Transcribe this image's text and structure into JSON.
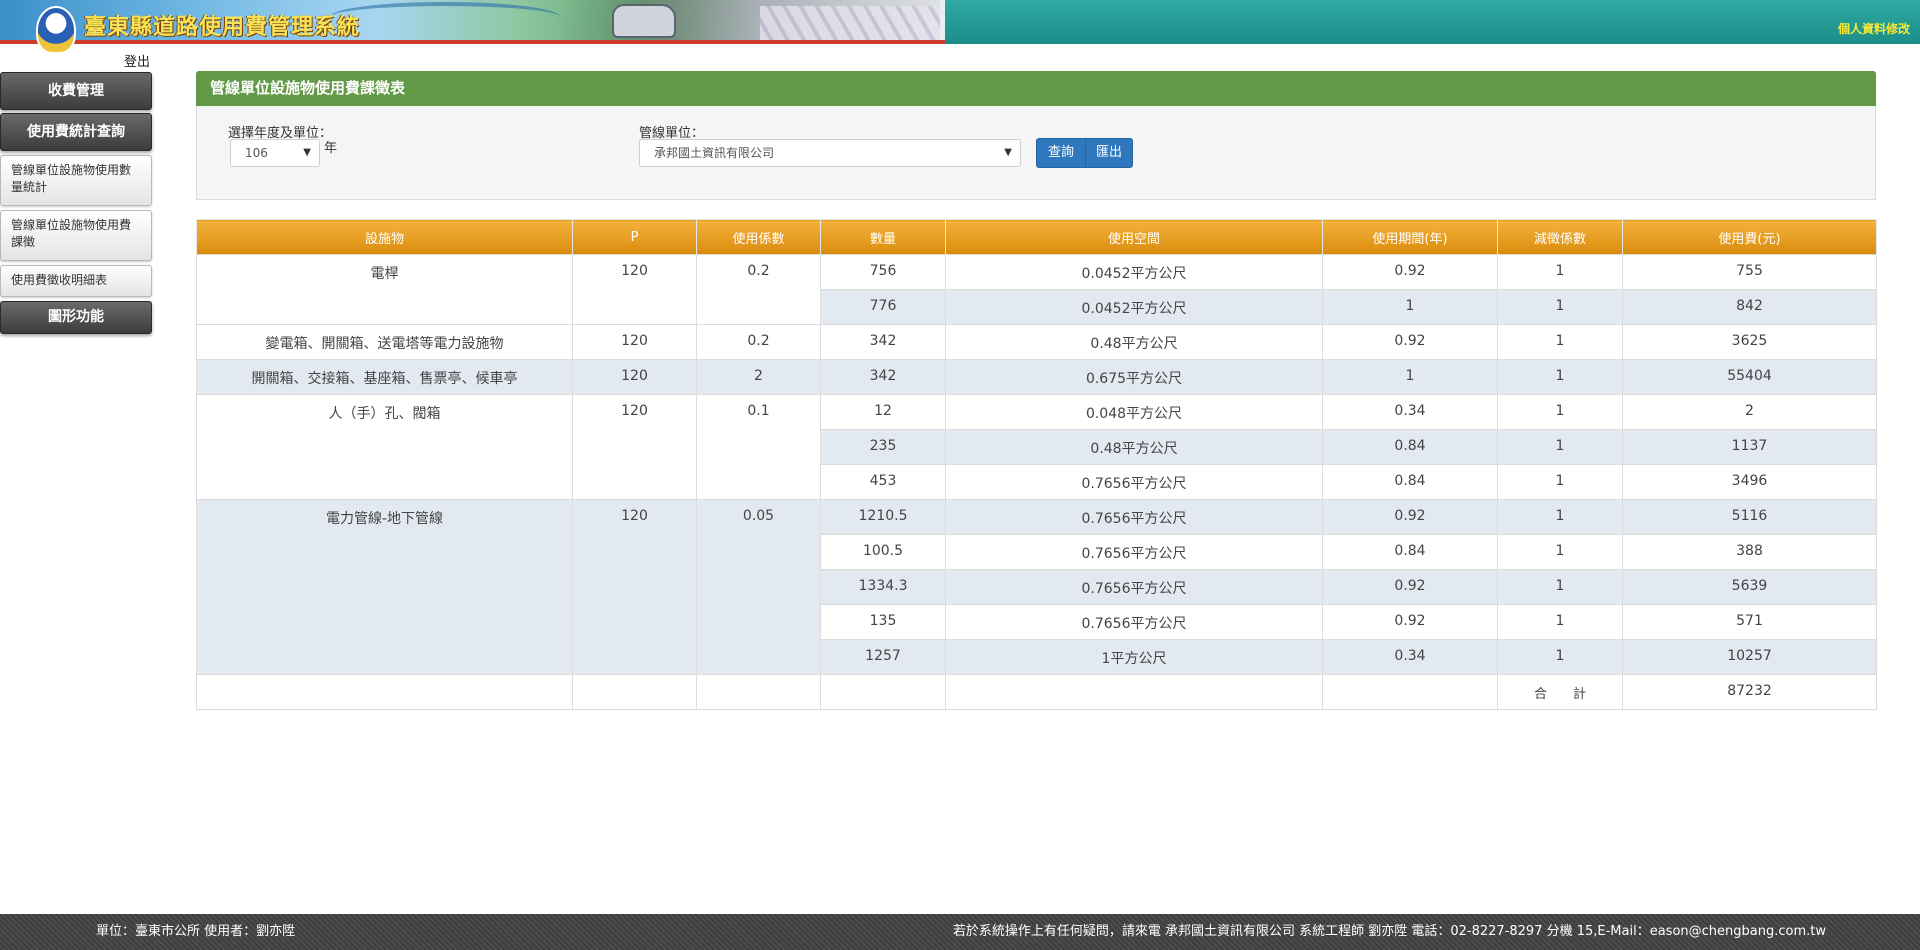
{
  "header": {
    "title": "臺東縣道路使用費管理系統",
    "profile_link": "個人資料修改"
  },
  "sidebar": {
    "logout": "登出",
    "items": [
      {
        "label": "收費管理"
      },
      {
        "label": "使用費統計查詢"
      },
      {
        "label": "管線單位設施物使用數量統計"
      },
      {
        "label": "管線單位設施物使用費課徵"
      },
      {
        "label": "使用費徵收明細表"
      },
      {
        "label": "圖形功能"
      }
    ]
  },
  "panel": {
    "title": "管線單位設施物使用費課徵表",
    "year_label": "選擇年度及單位：",
    "year_value": "106",
    "year_suffix": "年",
    "unit_label": "管線單位：",
    "unit_value": "承邦國土資訊有限公司",
    "query_btn": "查詢",
    "export_btn": "匯出"
  },
  "table": {
    "headers": [
      "設施物",
      "P",
      "使用係數",
      "數量",
      "使用空間",
      "使用期間(年)",
      "減徵係數",
      "使用費(元)"
    ],
    "groups": [
      {
        "facility": "電桿",
        "p": "120",
        "coef": "0.2",
        "rows": [
          {
            "qty": "756",
            "space": "0.0452平方公尺",
            "period": "0.92",
            "reduce": "1",
            "fee": "755"
          },
          {
            "qty": "776",
            "space": "0.0452平方公尺",
            "period": "1",
            "reduce": "1",
            "fee": "842"
          }
        ]
      },
      {
        "facility": "變電箱、開關箱、送電塔等電力設施物",
        "p": "120",
        "coef": "0.2",
        "rows": [
          {
            "qty": "342",
            "space": "0.48平方公尺",
            "period": "0.92",
            "reduce": "1",
            "fee": "3625"
          }
        ]
      },
      {
        "facility": "開關箱、交接箱、基座箱、售票亭、候車亭",
        "p": "120",
        "coef": "2",
        "rows": [
          {
            "qty": "342",
            "space": "0.675平方公尺",
            "period": "1",
            "reduce": "1",
            "fee": "55404"
          }
        ]
      },
      {
        "facility": "人（手）孔、閥箱",
        "p": "120",
        "coef": "0.1",
        "rows": [
          {
            "qty": "12",
            "space": "0.048平方公尺",
            "period": "0.34",
            "reduce": "1",
            "fee": "2"
          },
          {
            "qty": "235",
            "space": "0.48平方公尺",
            "period": "0.84",
            "reduce": "1",
            "fee": "1137"
          },
          {
            "qty": "453",
            "space": "0.7656平方公尺",
            "period": "0.84",
            "reduce": "1",
            "fee": "3496"
          }
        ]
      },
      {
        "facility": "電力管線-地下管線",
        "p": "120",
        "coef": "0.05",
        "rows": [
          {
            "qty": "1210.5",
            "space": "0.7656平方公尺",
            "period": "0.92",
            "reduce": "1",
            "fee": "5116"
          },
          {
            "qty": "100.5",
            "space": "0.7656平方公尺",
            "period": "0.84",
            "reduce": "1",
            "fee": "388"
          },
          {
            "qty": "1334.3",
            "space": "0.7656平方公尺",
            "period": "0.92",
            "reduce": "1",
            "fee": "5639"
          },
          {
            "qty": "135",
            "space": "0.7656平方公尺",
            "period": "0.92",
            "reduce": "1",
            "fee": "571"
          },
          {
            "qty": "1257",
            "space": "1平方公尺",
            "period": "0.34",
            "reduce": "1",
            "fee": "10257"
          }
        ]
      }
    ],
    "total_label": "合　　計",
    "total_value": "87232"
  },
  "footer": {
    "left": "單位：臺東市公所 使用者：劉亦陞",
    "right": "若於系統操作上有任何疑問，請來電 承邦國土資訊有限公司 系統工程師 劉亦陞 電話：02-8227-8297 分機 15,E-Mail：eason@chengbang.com.tw"
  },
  "colors": {
    "header_teal": "#1c8e8a",
    "title_yellow": "#f6e35a",
    "panel_green": "#629a48",
    "table_header_orange": "#e79f20",
    "row_alt_blue": "#e2e9f0",
    "button_blue": "#2f78bd"
  },
  "icons": [
    "county-logo-icon",
    "dropdown-caret-icon"
  ]
}
